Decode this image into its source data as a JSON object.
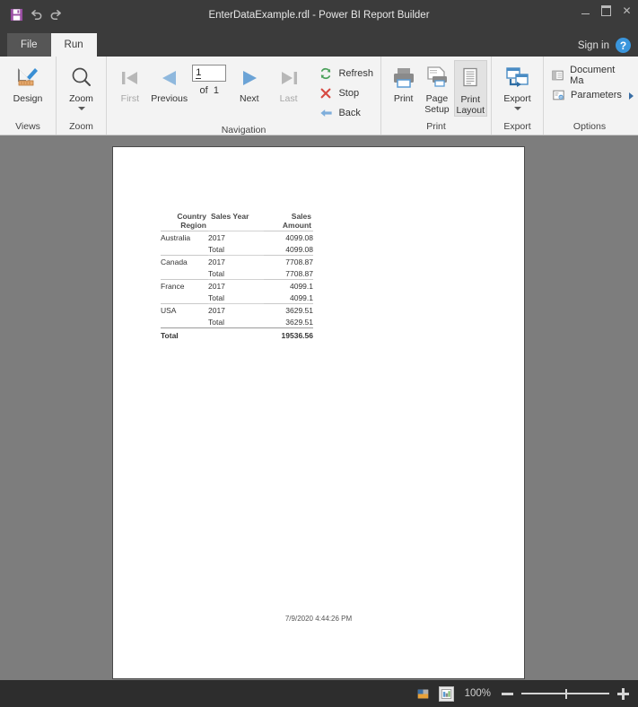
{
  "window": {
    "title": "EnterDataExample.rdl - Power BI Report Builder",
    "quick_access": [
      {
        "name": "save-icon",
        "label": "Save"
      },
      {
        "name": "undo-icon",
        "label": "Undo"
      },
      {
        "name": "redo-icon",
        "label": "Redo"
      }
    ],
    "controls": {
      "minimize": "–",
      "maximize": "❐",
      "close": "✕"
    }
  },
  "tabs": [
    {
      "label": "File",
      "active": false
    },
    {
      "label": "Run",
      "active": true
    }
  ],
  "account": {
    "sign_in_label": "Sign in",
    "help_label": "?"
  },
  "ribbon": {
    "groups": [
      {
        "name": "views",
        "label": "Views",
        "buttons": [
          {
            "label": "Design",
            "icon": "design-ruler-pencil-icon"
          }
        ]
      },
      {
        "name": "zoom",
        "label": "Zoom",
        "buttons": [
          {
            "label": "Zoom",
            "icon": "magnifier-icon",
            "has_dropdown": true
          }
        ]
      },
      {
        "name": "navigation",
        "label": "Navigation",
        "buttons": [
          {
            "label": "First",
            "icon": "first-page-icon",
            "disabled": true
          },
          {
            "label": "Previous",
            "icon": "previous-page-icon",
            "disabled": false
          },
          {
            "label": "Next",
            "icon": "next-page-icon",
            "disabled": false
          },
          {
            "label": "Last",
            "icon": "last-page-icon",
            "disabled": true
          }
        ],
        "page_input": {
          "value": "1",
          "of_label": "of",
          "total_pages": "1"
        },
        "commands": [
          {
            "label": "Refresh",
            "icon": "refresh-icon"
          },
          {
            "label": "Stop",
            "icon": "stop-x-icon"
          },
          {
            "label": "Back",
            "icon": "back-arrow-icon"
          }
        ]
      },
      {
        "name": "print",
        "label": "Print",
        "buttons": [
          {
            "label": "Print",
            "icon": "printer-icon"
          },
          {
            "label": "Page Setup",
            "label_line1": "Page",
            "label_line2": "Setup",
            "icon": "page-setup-icon"
          },
          {
            "label": "Print Layout",
            "label_line1": "Print",
            "label_line2": "Layout",
            "icon": "print-layout-icon",
            "selected": true
          }
        ]
      },
      {
        "name": "export",
        "label": "Export",
        "buttons": [
          {
            "label": "Export",
            "icon": "export-icon",
            "has_dropdown": true
          }
        ]
      },
      {
        "name": "options",
        "label": "Options",
        "items": [
          {
            "label": "Document Mа",
            "icon": "document-map-icon"
          },
          {
            "label": "Parameters",
            "icon": "parameters-icon"
          }
        ]
      }
    ]
  },
  "report": {
    "table": {
      "headers": {
        "country_line1": "Country",
        "country_line2": "Region",
        "year": "Sales Year",
        "amount_line1": "Sales",
        "amount_line2": "Amount"
      },
      "rows": [
        {
          "country": "Australia",
          "year": "2017",
          "amount": "4099.08",
          "type": "detail"
        },
        {
          "country": "",
          "year": "Total",
          "amount": "4099.08",
          "type": "subtotal"
        },
        {
          "country": "Canada",
          "year": "2017",
          "amount": "7708.87",
          "type": "detail"
        },
        {
          "country": "",
          "year": "Total",
          "amount": "7708.87",
          "type": "subtotal"
        },
        {
          "country": "France",
          "year": "2017",
          "amount": "4099.1",
          "type": "detail"
        },
        {
          "country": "",
          "year": "Total",
          "amount": "4099.1",
          "type": "subtotal"
        },
        {
          "country": "USA",
          "year": "2017",
          "amount": "3629.51",
          "type": "detail"
        },
        {
          "country": "",
          "year": "Total",
          "amount": "3629.51",
          "type": "subtotal"
        }
      ],
      "grand_total": {
        "label": "Total",
        "year": "",
        "amount": "19536.56"
      }
    },
    "timestamp": "7/9/2020 4:44:26 PM"
  },
  "statusbar": {
    "view_icons": [
      {
        "name": "normal-view-icon",
        "selected": false
      },
      {
        "name": "page-view-icon",
        "selected": true
      }
    ],
    "zoom_level": "100%",
    "zoom_out_label": "−",
    "zoom_in_label": "+"
  },
  "colors": {
    "brand_purple": "#9a4fa3",
    "accent_blue": "#3a96dd",
    "chrome_dark": "#3b3b3b",
    "ribbon_bg": "#f3f3f3",
    "canvas_gray": "#7d7d7d"
  }
}
